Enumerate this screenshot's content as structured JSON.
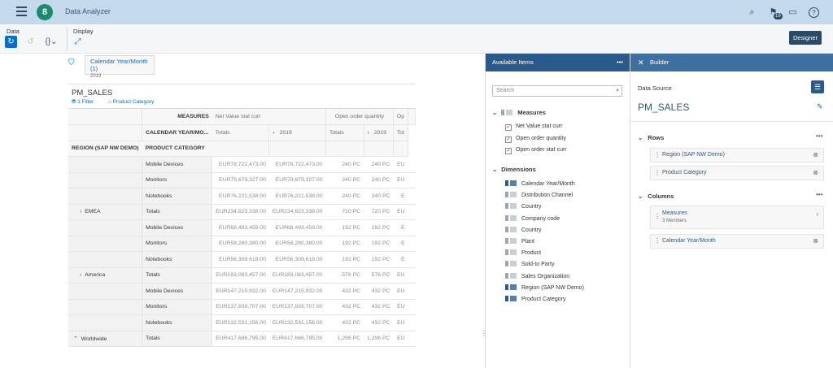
{
  "shell": {
    "title": "Data Analyzer",
    "notification_count": "19",
    "logo_text": "8"
  },
  "toolbar": {
    "data_label": "Data",
    "display_label": "Display",
    "designer_label": "Designer"
  },
  "filter": {
    "title": "Calendar Year/Month (1)",
    "value": "2019"
  },
  "table_title": "PM_SALES",
  "table_sub": {
    "filter": "1 Filter",
    "product": "Product Category"
  },
  "grid": {
    "header1": [
      "MEASURES",
      "Net Value stat curr",
      "",
      "Open order quantity",
      "",
      "Op"
    ],
    "header2": [
      "CALENDAR YEAR/MO...",
      "Totals",
      "2019",
      "Totals",
      "2019",
      "Tot"
    ],
    "header3": [
      "REGION (SAP NW DEMO)",
      "PRODUCT CATEGORY"
    ],
    "rows": [
      {
        "region": "",
        "cat": "Mobile Devices",
        "v": [
          "EUR78,722,473.00",
          "EUR78,722,473.00",
          "240 PC",
          "240 PC",
          "EU"
        ]
      },
      {
        "region": "",
        "cat": "Monitors",
        "v": [
          "EUR79,679,327.00",
          "EUR79,679,327.00",
          "240 PC",
          "240 PC",
          "EU"
        ]
      },
      {
        "region": "",
        "cat": "Notebooks",
        "v": [
          "EUR76,221,538.00",
          "EUR76,221,538.00",
          "240 PC",
          "240 PC",
          "E"
        ]
      },
      {
        "region": "EMEA",
        "cat": "Totals",
        "v": [
          "EUR234,623,338.00",
          "EUR234,623,338.00",
          "720 PC",
          "720 PC",
          "EU"
        ]
      },
      {
        "region": "",
        "cat": "Mobile Devices",
        "v": [
          "EUR68,493,459.00",
          "EUR68,493,459.00",
          "192 PC",
          "192 PC",
          "E"
        ]
      },
      {
        "region": "",
        "cat": "Monitors",
        "v": [
          "EUR58,280,380.00",
          "EUR58,280,380.00",
          "192 PC",
          "192 PC",
          "E"
        ]
      },
      {
        "region": "",
        "cat": "Notebooks",
        "v": [
          "EUR56,309,618.00",
          "EUR56,309,618.00",
          "192 PC",
          "192 PC",
          "E"
        ]
      },
      {
        "region": "America",
        "cat": "Totals",
        "v": [
          "EUR183,063,457.00",
          "EUR183,063,457.00",
          "576 PC",
          "576 PC",
          "EU"
        ]
      },
      {
        "region": "",
        "cat": "Mobile Devices",
        "v": [
          "EUR147,215,932.00",
          "EUR147,215,932.00",
          "432 PC",
          "432 PC",
          "EU"
        ]
      },
      {
        "region": "",
        "cat": "Monitors",
        "v": [
          "EUR137,939,707.00",
          "EUR137,939,707.00",
          "432 PC",
          "432 PC",
          "EU"
        ]
      },
      {
        "region": "",
        "cat": "Notebooks",
        "v": [
          "EUR132,531,156.00",
          "EUR132,531,156.00",
          "432 PC",
          "432 PC",
          "EU"
        ]
      },
      {
        "region": "Worldwide",
        "cat": "Totals",
        "v": [
          "EUR417,686,795.00",
          "EUR417,686,795.00",
          "1,296 PC",
          "1,296 PC",
          "EU"
        ]
      }
    ]
  },
  "available": {
    "title": "Available Items",
    "search_placeholder": "Search",
    "measures_label": "Measures",
    "measures": [
      "Net Value stat curr",
      "Open order quantity",
      "Open order stat curr"
    ],
    "dimensions_label": "Dimensions",
    "dimensions": [
      "Calendar Year/Month",
      "Distribution Channel",
      "Country",
      "Company code",
      "Country",
      "Plant",
      "Product",
      "Sold-to Party",
      "Sales Organization",
      "Region (SAP NW Demo)",
      "Product Category"
    ]
  },
  "builder": {
    "title": "Builder",
    "data_source_label": "Data Source",
    "data_source": "PM_SALES",
    "rows_label": "Rows",
    "rows": [
      "Region (SAP NW Demo)",
      "Product Category"
    ],
    "columns_label": "Columns",
    "columns": [
      {
        "label": "Measures",
        "sub": "3 Members"
      },
      {
        "label": "Calendar Year/Month",
        "sub": ""
      }
    ]
  }
}
